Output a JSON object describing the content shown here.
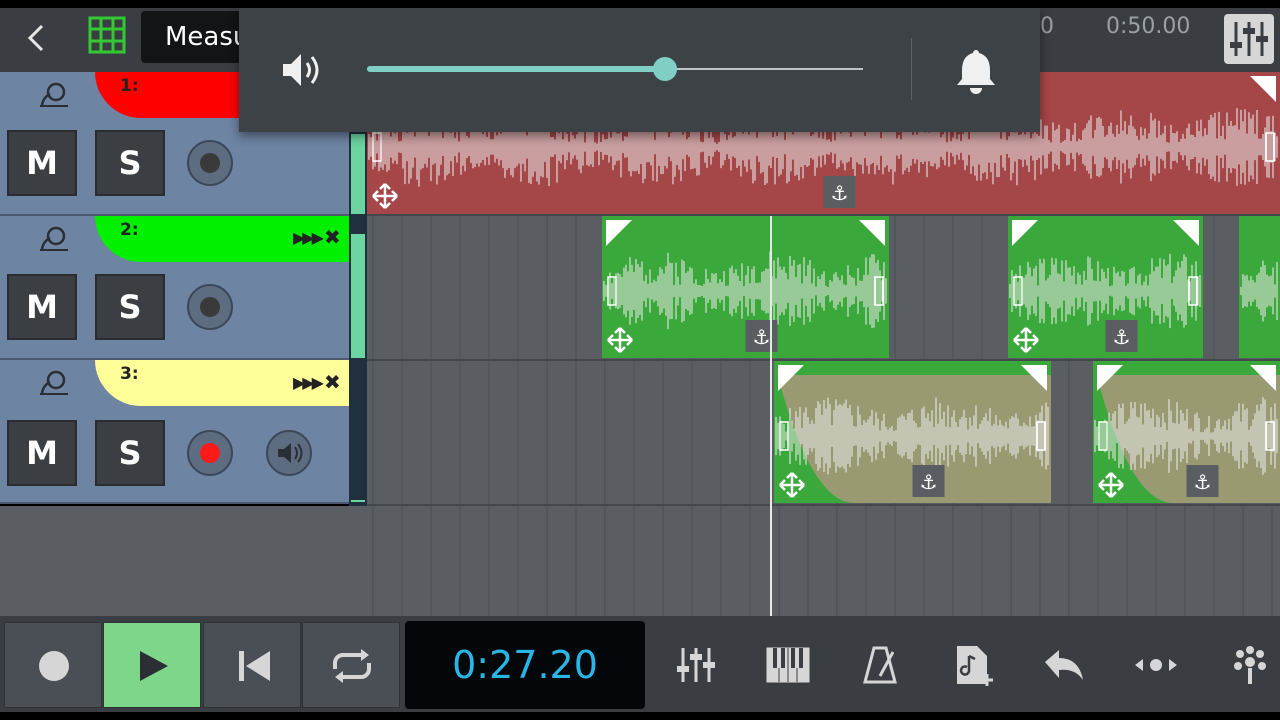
{
  "topbar": {
    "back_label": "‹",
    "grid_icon": "grid-icon",
    "mode_select_value": "Measures",
    "ruler_labels": [
      "0",
      "0:50.00"
    ],
    "mixer_icon": "mixer-sliders-icon"
  },
  "tracks": [
    {
      "number_label": "1:",
      "color": "#ff0000",
      "mute_label": "M",
      "solo_label": "S",
      "record_armed": false,
      "has_fx_controls": false,
      "clip_color": "#b04545"
    },
    {
      "number_label": "2:",
      "color": "#00f000",
      "mute_label": "M",
      "solo_label": "S",
      "record_armed": false,
      "has_fx_controls": true,
      "clip_color": "#3aaa3a"
    },
    {
      "number_label": "3:",
      "color": "#ffff99",
      "mute_label": "M",
      "solo_label": "S",
      "record_armed": true,
      "has_fx_controls": true,
      "has_monitor": true,
      "clip_color": "#3aaa3a"
    }
  ],
  "transport": {
    "time": "0:27.20",
    "buttons": [
      "record-icon",
      "play-icon",
      "skip-to-start-icon",
      "loop-icon"
    ],
    "tools": [
      "mixer-icon",
      "piano-keys-icon",
      "metronome-icon",
      "add-audio-file-icon",
      "undo-icon",
      "zoom-fit-icon",
      "settings-icon"
    ]
  },
  "volume_overlay": {
    "level": 0.6,
    "speaker_icon": "speaker-icon",
    "notification_icon": "bell-icon"
  },
  "colors": {
    "accent": "#29b6e6",
    "play_active": "#7dd68a",
    "slider": "#7fcfc4"
  }
}
